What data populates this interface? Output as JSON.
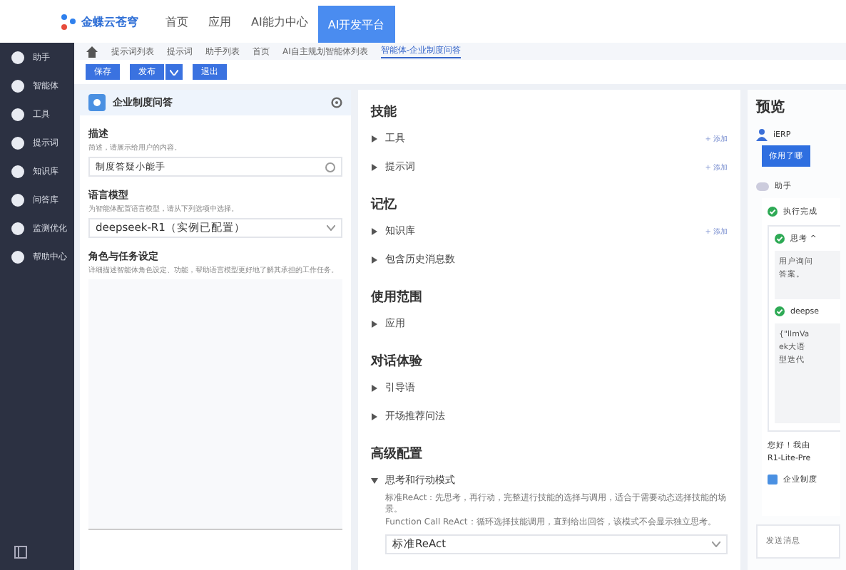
{
  "topbar": {
    "logo": "金蝶云苍穹",
    "nav": [
      {
        "label": "首页",
        "selected": false
      },
      {
        "label": "应用",
        "selected": false
      },
      {
        "label": "AI能力中心",
        "selected": false
      },
      {
        "label": "AI开发平台",
        "selected": true
      }
    ]
  },
  "sidebar": {
    "items": [
      {
        "label": "助手"
      },
      {
        "label": "智能体"
      },
      {
        "label": "工具"
      },
      {
        "label": "提示词"
      },
      {
        "label": "知识库"
      },
      {
        "label": "问答库"
      },
      {
        "label": "监测优化"
      },
      {
        "label": "帮助中心"
      }
    ]
  },
  "breadcrumb": [
    {
      "label": "提示词列表",
      "selected": false
    },
    {
      "label": "提示词",
      "selected": false
    },
    {
      "label": "助手列表",
      "selected": false
    },
    {
      "label": "首页",
      "selected": false
    },
    {
      "label": "AI自主规划智能体列表",
      "selected": false
    },
    {
      "label": "智能体-企业制度问答",
      "selected": true
    }
  ],
  "toolbar": [
    "保存",
    "发布",
    "退出"
  ],
  "agent": {
    "name": "企业制度问答",
    "fields": [
      {
        "kind": "input",
        "label": "描述",
        "hint": "简述，请展示给用户的内容。",
        "value": "制度答疑小能手"
      },
      {
        "kind": "select",
        "label": "语言模型",
        "hint": "为智能体配置语言模型，请从下列选项中选择。",
        "value": "deepseek-R1（实例已配置）"
      },
      {
        "kind": "textarea",
        "label": "角色与任务设定",
        "hint": "详细描述智能体角色设定、功能，帮助语言模型更好地了解其承担的工作任务。"
      }
    ]
  },
  "config": {
    "sections": [
      {
        "title": "技能",
        "items": [
          {
            "label": "工具",
            "action": "+ 添加",
            "expanded": false
          },
          {
            "label": "提示词",
            "action": "+ 添加",
            "expanded": false
          }
        ]
      },
      {
        "title": "记忆",
        "items": [
          {
            "label": "知识库",
            "action": "+ 添加",
            "expanded": false
          },
          {
            "label": "包含历史消息数",
            "expanded": false
          }
        ]
      },
      {
        "title": "使用范围",
        "items": [
          {
            "label": "应用",
            "expanded": false
          }
        ]
      },
      {
        "title": "对话体验",
        "items": [
          {
            "label": "引导语",
            "expanded": false
          },
          {
            "label": "开场推荐问法",
            "expanded": false
          }
        ]
      },
      {
        "title": "高级配置",
        "items": [
          {
            "label": "思考和行动模式",
            "expanded": true,
            "desc": [
              "标准ReAct：先思考，再行动，完整进行技能的选择与调用，适合于需要动态选择技能的场景。",
              "Function Call ReAct：循环选择技能调用，直到给出回答，该模式不会显示独立思考。"
            ],
            "select": "标准ReAct"
          }
        ]
      }
    ]
  },
  "preview": {
    "title": "预览",
    "user": "iERP",
    "question": "你用了哪",
    "assistant": "助手",
    "status": "执行完成",
    "think": "思考 ^",
    "think_text": [
      "用户询问",
      "答案。"
    ],
    "tool": "deepse",
    "tool_text": [
      "{\"llmVa",
      "ek大语",
      "型迭代"
    ],
    "answer": [
      "您好！我由",
      "R1-Lite-Pre"
    ],
    "chip": "企业制度",
    "placeholder": "发送消息"
  }
}
